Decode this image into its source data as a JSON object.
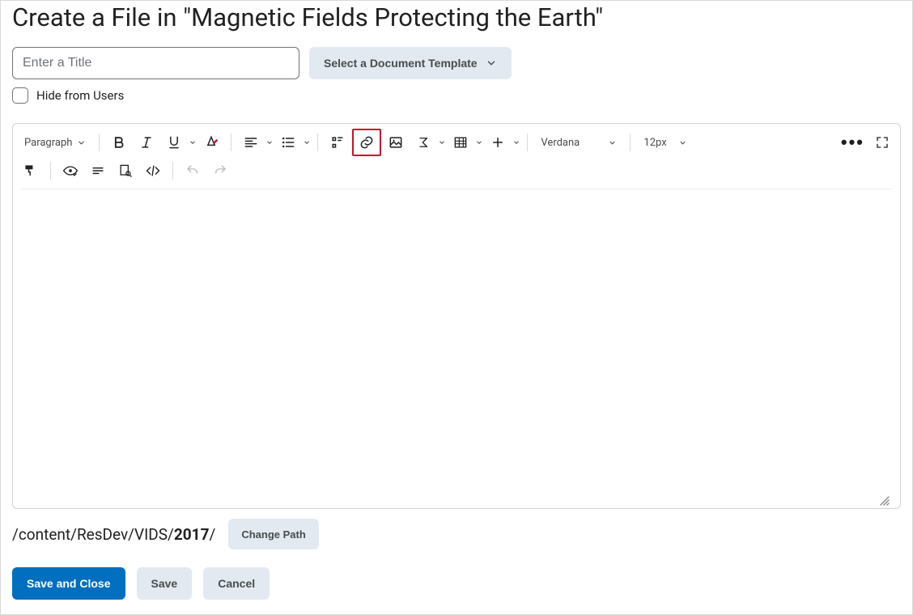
{
  "page_title": "Create a File in \"Magnetic Fields Protecting the Earth\"",
  "title_input": {
    "value": "",
    "placeholder": "Enter a Title"
  },
  "template_button": "Select a Document Template",
  "hide_checkbox": {
    "checked": false,
    "label": "Hide from Users"
  },
  "toolbar": {
    "paragraph": "Paragraph",
    "font_family": "Verdana",
    "font_size": "12px",
    "more": "⋯"
  },
  "path": {
    "prefix": "/content/ResDev/VIDS/",
    "bold": "2017",
    "suffix": "/"
  },
  "change_path": "Change Path",
  "actions": {
    "save_close": "Save and Close",
    "save": "Save",
    "cancel": "Cancel"
  }
}
